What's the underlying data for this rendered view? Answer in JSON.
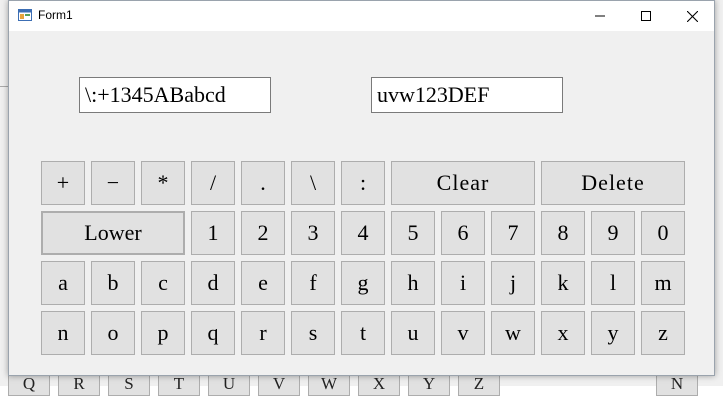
{
  "window": {
    "title": "Form1",
    "icons": {
      "app": "form-app-icon",
      "minimize": "minimize-icon",
      "maximize": "maximize-icon",
      "close": "close-icon"
    }
  },
  "textboxes": [
    {
      "value": "\\:+1345ABabcd"
    },
    {
      "value": "uvw123DEF"
    }
  ],
  "keyboard": {
    "row1": [
      "+",
      "−",
      "*",
      "/",
      ".",
      "\\",
      ":",
      "Clear",
      "Delete"
    ],
    "row2": [
      "Lower",
      "1",
      "2",
      "3",
      "4",
      "5",
      "6",
      "7",
      "8",
      "9",
      "0"
    ],
    "row3": [
      "a",
      "b",
      "c",
      "d",
      "e",
      "f",
      "g",
      "h",
      "i",
      "j",
      "k",
      "l",
      "m"
    ],
    "row4": [
      "n",
      "o",
      "p",
      "q",
      "r",
      "s",
      "t",
      "u",
      "v",
      "w",
      "x",
      "y",
      "z"
    ]
  },
  "background_app": {
    "partial_labels": [
      "Q",
      "R",
      "S",
      "T",
      "U",
      "V",
      "W",
      "X",
      "Y",
      "Z",
      "N"
    ]
  },
  "colors": {
    "window_bg": "#f0f0f0",
    "key_bg": "#e1e1e1",
    "key_border": "#adadad",
    "titlebar_bg": "#ffffff"
  }
}
